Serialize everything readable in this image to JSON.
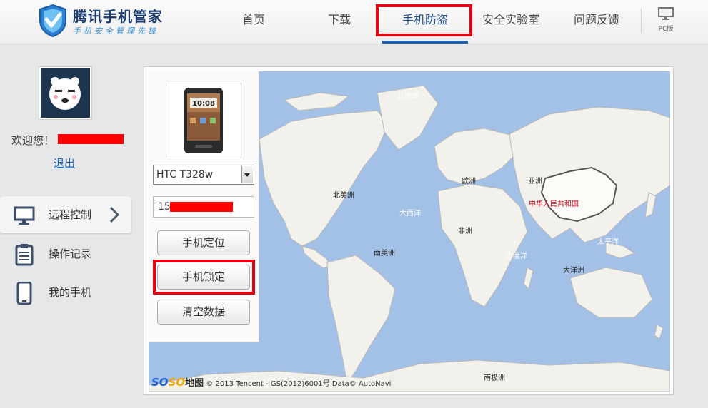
{
  "brand": {
    "title": "腾讯手机管家",
    "subtitle": "手机安全管理先锋"
  },
  "nav": {
    "items": [
      {
        "label": "首页"
      },
      {
        "label": "下载"
      },
      {
        "label": "手机防盗",
        "active": true
      },
      {
        "label": "安全实验室"
      },
      {
        "label": "问题反馈"
      }
    ],
    "pc_label": "PC版"
  },
  "user": {
    "welcome": "欢迎您！",
    "logout": "退出"
  },
  "sidebar": {
    "items": [
      {
        "label": "远程控制",
        "icon": "monitor-icon",
        "active": true
      },
      {
        "label": "操作记录",
        "icon": "clipboard-icon"
      },
      {
        "label": "我的手机",
        "icon": "phone-icon"
      }
    ]
  },
  "device": {
    "model": "HTC T328w",
    "phone_prefix": "15",
    "phone_time": "10:08"
  },
  "actions": {
    "locate": "手机定位",
    "lock": "手机锁定",
    "wipe": "清空数据"
  },
  "map": {
    "labels": {
      "arctic": "北冰洋",
      "europe": "欧洲",
      "asia": "亚洲",
      "north_america": "北美洲",
      "china": "中华人民共和国",
      "atlantic": "大西洋",
      "africa": "非洲",
      "pacific": "太平洋",
      "south_america": "南美洲",
      "indian": "印度洋",
      "oceania": "大洋洲",
      "antarctica": "南极洲"
    },
    "credit_logo_so1": "SO",
    "credit_logo_so2": "SO",
    "credit_logo_map": "地图",
    "credit_text": "© 2013 Tencent - GS(2012)6001号  Data© AutoNavi"
  },
  "colors": {
    "highlight": "#e50012",
    "nav_active": "#1f5ea8",
    "link": "#1e5fa8",
    "ocean": "#a3c0e6",
    "land": "#f2f1ec"
  }
}
